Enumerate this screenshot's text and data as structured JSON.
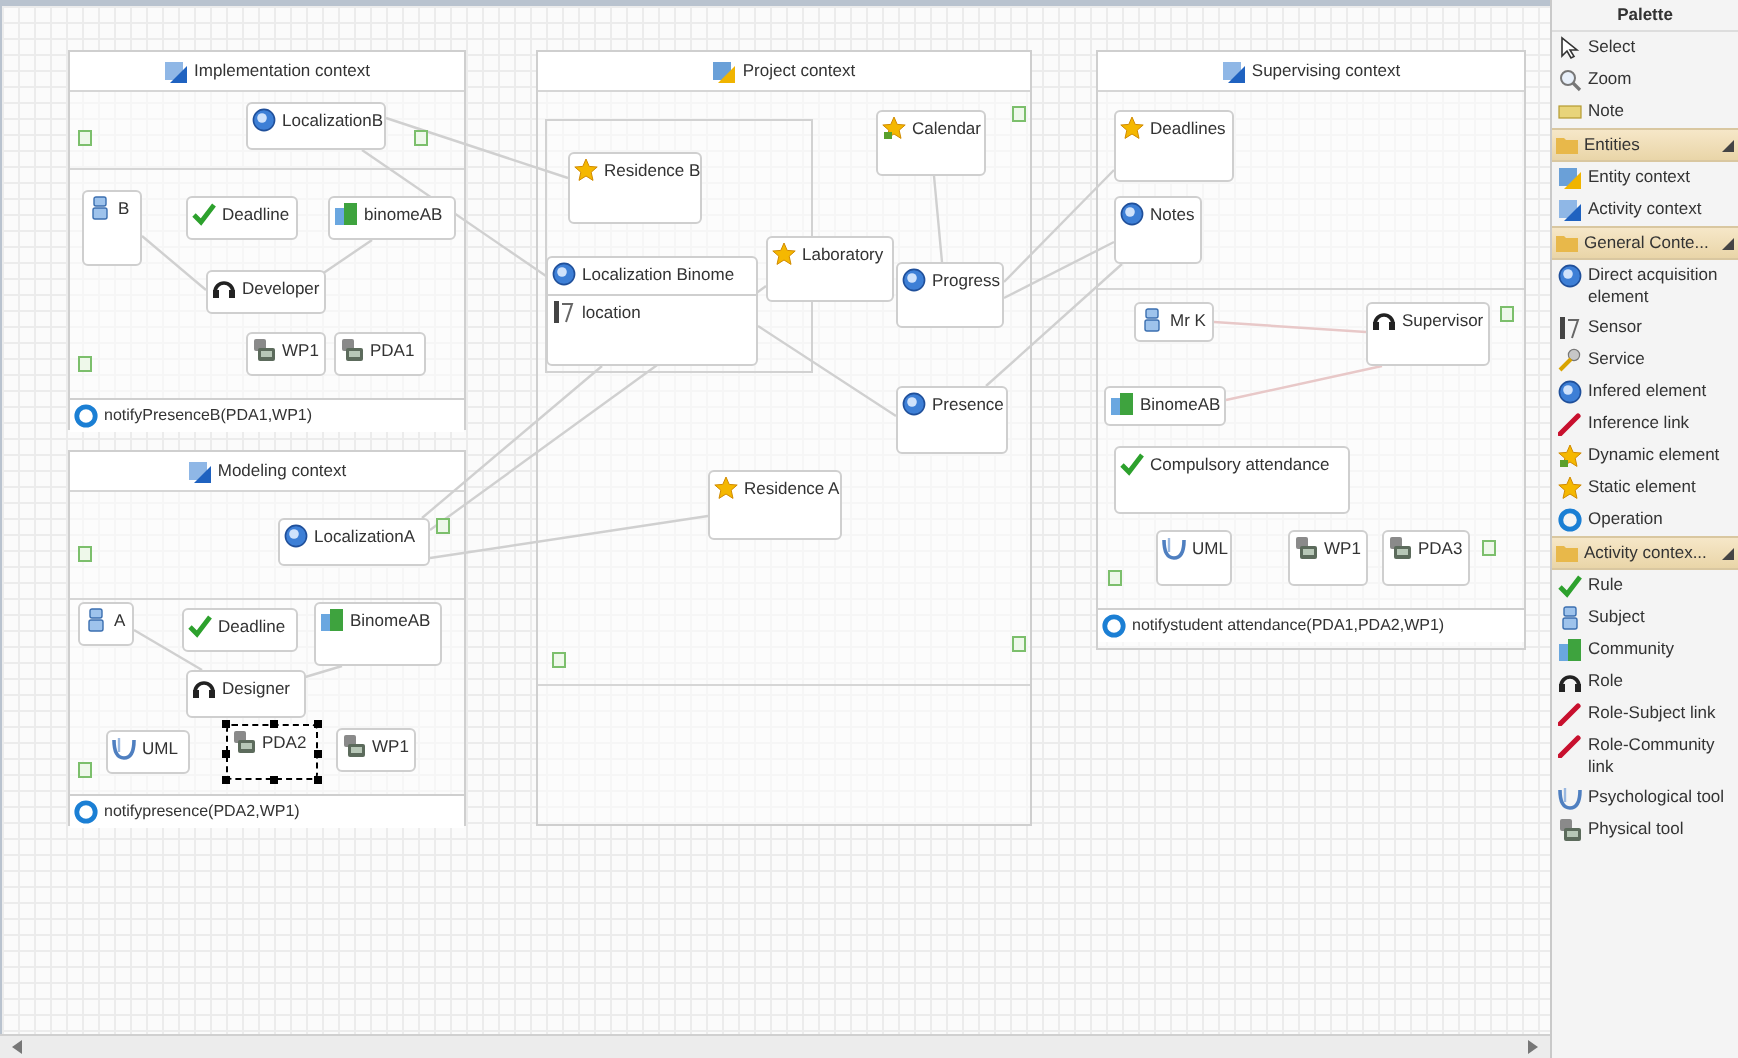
{
  "canvas": {
    "contexts": [
      {
        "title": "Implementation context",
        "kind": "activity",
        "operation": "notifyPresenceB(PDA1,WP1)",
        "nodes": [
          {
            "label": "LocalizationB",
            "kind": "inferred",
            "selected": false
          },
          {
            "label": "B",
            "kind": "subject",
            "selected": false
          },
          {
            "label": "Deadline",
            "kind": "rule",
            "selected": false
          },
          {
            "label": "binomeAB",
            "kind": "community",
            "selected": false
          },
          {
            "label": "Developer",
            "kind": "role",
            "selected": false
          },
          {
            "label": "WP1",
            "kind": "physical",
            "selected": false
          },
          {
            "label": "PDA1",
            "kind": "physical",
            "selected": false
          }
        ]
      },
      {
        "title": "Modeling context",
        "kind": "activity",
        "operation": "notifypresence(PDA2,WP1)",
        "nodes": [
          {
            "label": "LocalizationA",
            "kind": "inferred",
            "selected": false
          },
          {
            "label": "A",
            "kind": "subject",
            "selected": false
          },
          {
            "label": "Deadline",
            "kind": "rule",
            "selected": false
          },
          {
            "label": "BinomeAB",
            "kind": "community",
            "selected": false
          },
          {
            "label": "Designer",
            "kind": "role",
            "selected": false
          },
          {
            "label": "UML",
            "kind": "psychological",
            "selected": false
          },
          {
            "label": "PDA2",
            "kind": "physical",
            "selected": true
          },
          {
            "label": "WP1",
            "kind": "physical",
            "selected": false
          }
        ]
      },
      {
        "title": "Project context",
        "kind": "entity",
        "nodes": [
          {
            "label": "Residence B",
            "kind": "static",
            "selected": false
          },
          {
            "label": "Localization Binome",
            "kind": "inferred",
            "selected": false,
            "children": [
              {
                "label": "location",
                "kind": "sensor"
              }
            ]
          },
          {
            "label": "Laboratory",
            "kind": "static",
            "selected": false
          },
          {
            "label": "Calendar",
            "kind": "dynamic",
            "selected": false
          },
          {
            "label": "Progress",
            "kind": "inferred",
            "selected": false
          },
          {
            "label": "Presence",
            "kind": "inferred",
            "selected": false
          },
          {
            "label": "Residence A",
            "kind": "static",
            "selected": false
          }
        ]
      },
      {
        "title": "Supervising context",
        "kind": "activity",
        "operation": "notifystudent attendance(PDA1,PDA2,WP1)",
        "nodes": [
          {
            "label": "Deadlines",
            "kind": "static",
            "selected": false
          },
          {
            "label": "Notes",
            "kind": "inferred",
            "selected": false
          },
          {
            "label": "Mr K",
            "kind": "subject",
            "selected": false
          },
          {
            "label": "Supervisor",
            "kind": "role",
            "selected": false
          },
          {
            "label": "BinomeAB",
            "kind": "community",
            "selected": false
          },
          {
            "label": "Compulsory attendance",
            "kind": "rule",
            "selected": false
          },
          {
            "label": "UML",
            "kind": "psychological",
            "selected": false
          },
          {
            "label": "WP1",
            "kind": "physical",
            "selected": false
          },
          {
            "label": "PDA3",
            "kind": "physical",
            "selected": false
          }
        ]
      }
    ]
  },
  "palette": {
    "title": "Palette",
    "items": [
      {
        "kind": "tool",
        "label": "Select"
      },
      {
        "kind": "tool",
        "label": "Zoom"
      },
      {
        "kind": "tool",
        "label": "Note"
      },
      {
        "kind": "drawer",
        "label": "Entities",
        "expanded": true
      },
      {
        "kind": "tool",
        "label": "Entity context"
      },
      {
        "kind": "tool",
        "label": "Activity context"
      },
      {
        "kind": "drawer",
        "label": "General Conte...",
        "expanded": true
      },
      {
        "kind": "tool",
        "label": "Direct acquisition element"
      },
      {
        "kind": "tool",
        "label": "Sensor"
      },
      {
        "kind": "tool",
        "label": "Service"
      },
      {
        "kind": "tool",
        "label": "Infered element"
      },
      {
        "kind": "tool",
        "label": "Inference link"
      },
      {
        "kind": "tool",
        "label": "Dynamic element"
      },
      {
        "kind": "tool",
        "label": "Static element"
      },
      {
        "kind": "tool",
        "label": "Operation"
      },
      {
        "kind": "drawer",
        "label": "Activity contex...",
        "expanded": true
      },
      {
        "kind": "tool",
        "label": "Rule"
      },
      {
        "kind": "tool",
        "label": "Subject"
      },
      {
        "kind": "tool",
        "label": "Community"
      },
      {
        "kind": "tool",
        "label": "Role"
      },
      {
        "kind": "tool",
        "label": "Role-Subject link"
      },
      {
        "kind": "tool",
        "label": "Role-Community link"
      },
      {
        "kind": "tool",
        "label": "Psychological tool"
      },
      {
        "kind": "tool",
        "label": "Physical tool"
      }
    ]
  }
}
